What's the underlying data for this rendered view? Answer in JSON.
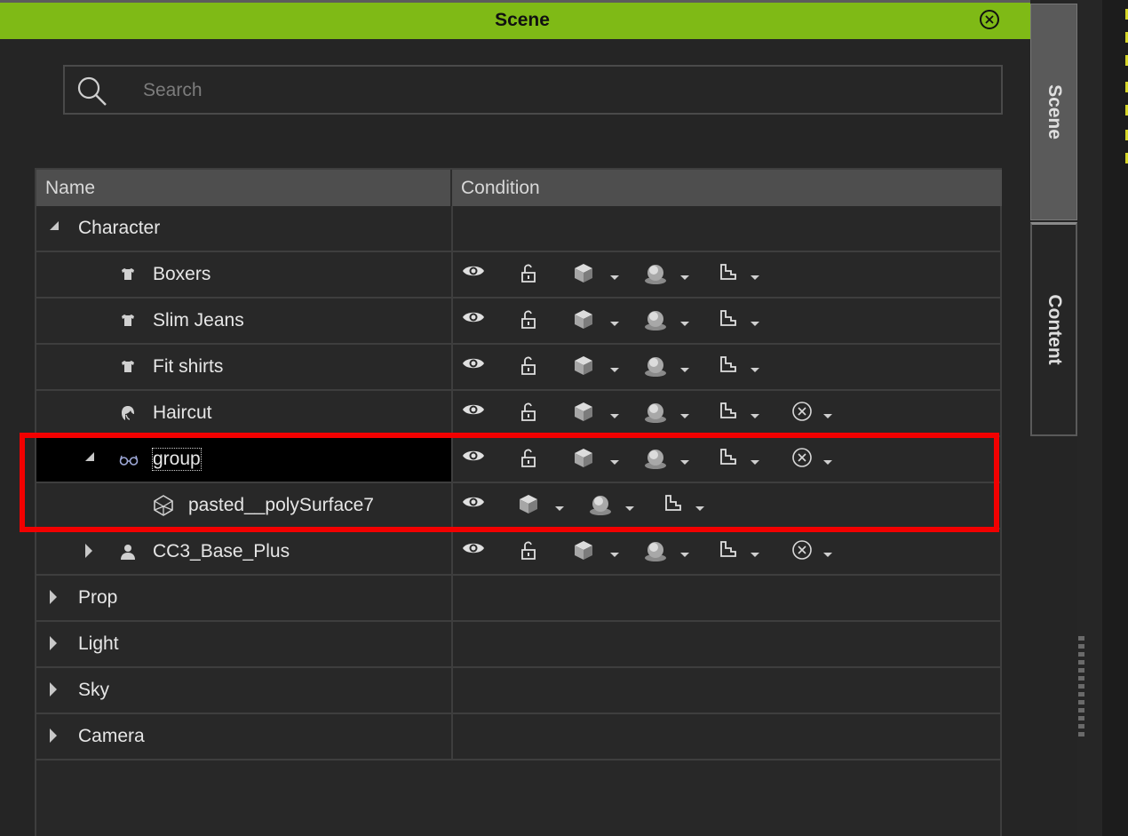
{
  "panel": {
    "title": "Scene",
    "close_icon": "close-circle-icon"
  },
  "search": {
    "placeholder": "Search",
    "value": ""
  },
  "table": {
    "headers": {
      "name": "Name",
      "condition": "Condition"
    },
    "rows": [
      {
        "label": "Character",
        "level": 0,
        "expander": "expanded",
        "icon": null,
        "conditions": []
      },
      {
        "label": "Boxers",
        "level": 2,
        "expander": null,
        "icon": "cloth-icon",
        "conditions": [
          "eye-icon",
          "unlock-icon",
          "cube-icon",
          "sphere-icon",
          "texture-icon"
        ]
      },
      {
        "label": "Slim Jeans",
        "level": 2,
        "expander": null,
        "icon": "cloth-icon",
        "conditions": [
          "eye-icon",
          "unlock-icon",
          "cube-icon",
          "sphere-icon",
          "texture-icon"
        ]
      },
      {
        "label": "Fit shirts",
        "level": 2,
        "expander": null,
        "icon": "cloth-icon",
        "conditions": [
          "eye-icon",
          "unlock-icon",
          "cube-icon",
          "sphere-icon",
          "texture-icon"
        ]
      },
      {
        "label": "Haircut",
        "level": 2,
        "expander": null,
        "icon": "hair-icon",
        "conditions": [
          "eye-icon",
          "unlock-icon",
          "cube-icon",
          "sphere-icon",
          "texture-icon",
          "x-circle-icon"
        ]
      },
      {
        "label": "group",
        "level": 1,
        "expander": "expanded",
        "icon": "glasses-icon",
        "selected": true,
        "conditions": [
          "eye-icon",
          "unlock-icon",
          "cube-icon",
          "sphere-icon",
          "texture-icon",
          "x-circle-icon"
        ]
      },
      {
        "label": "pasted__polySurface7",
        "level": 3,
        "expander": null,
        "icon": "mesh-icon",
        "conditions": [
          "eye-icon",
          "cube-icon",
          "sphere-icon",
          "texture-icon"
        ]
      },
      {
        "label": "CC3_Base_Plus",
        "level": 1,
        "expander": "collapsed",
        "icon": "person-icon",
        "conditions": [
          "eye-icon",
          "unlock-icon",
          "cube-icon",
          "sphere-icon",
          "texture-icon",
          "x-circle-icon"
        ]
      },
      {
        "label": "Prop",
        "level": 0,
        "expander": "collapsed",
        "icon": null,
        "conditions": []
      },
      {
        "label": "Light",
        "level": 0,
        "expander": "collapsed",
        "icon": null,
        "conditions": []
      },
      {
        "label": "Sky",
        "level": 0,
        "expander": "collapsed",
        "icon": null,
        "conditions": []
      },
      {
        "label": "Camera",
        "level": 0,
        "expander": "collapsed",
        "icon": null,
        "conditions": []
      }
    ]
  },
  "side_tabs": [
    {
      "label": "Scene",
      "active": true
    },
    {
      "label": "Content",
      "active": false
    }
  ],
  "colors": {
    "title_bar": "#7fba16",
    "highlight_box": "#f20000",
    "background": "#282828"
  }
}
